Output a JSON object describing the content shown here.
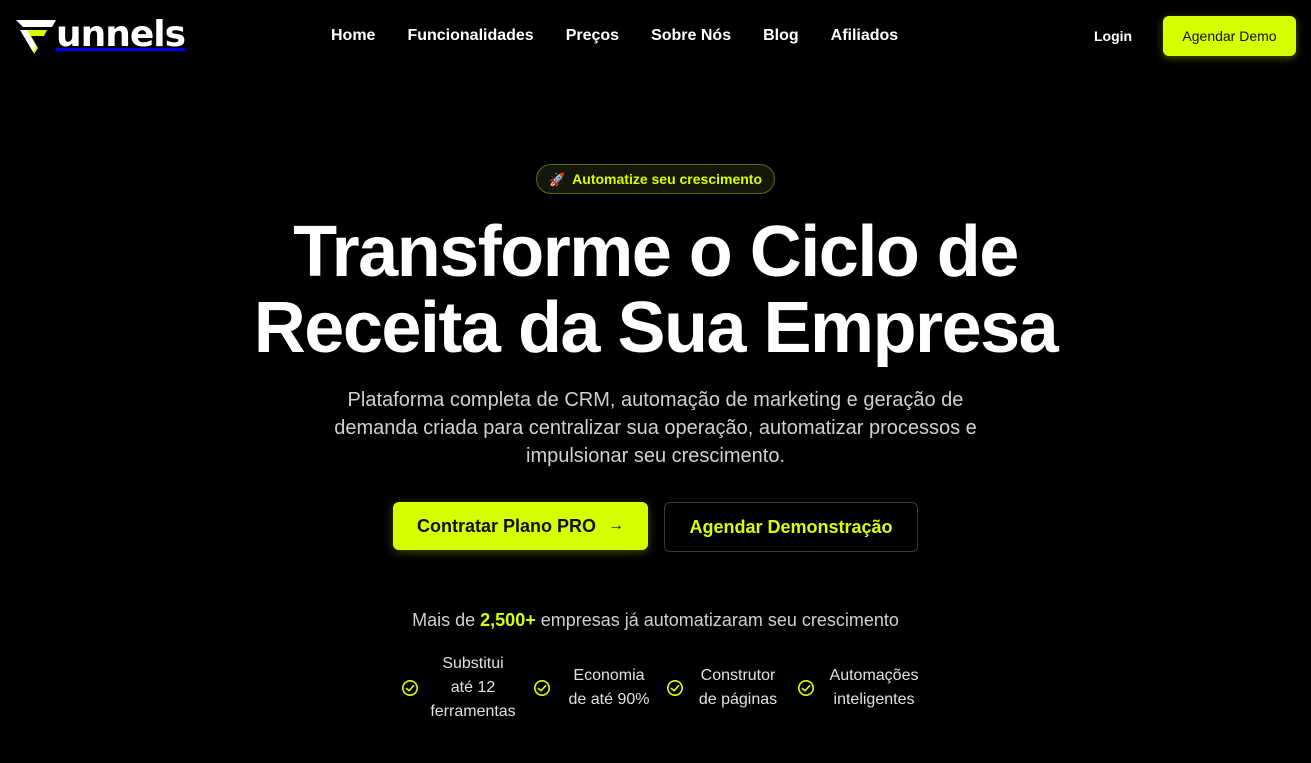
{
  "brand": {
    "name": "unnels",
    "accent": "#d7ff00"
  },
  "nav": {
    "items": [
      "Home",
      "Funcionalidades",
      "Preços",
      "Sobre Nós",
      "Blog",
      "Afiliados"
    ],
    "login": "Login",
    "demo_button": "Agendar Demo"
  },
  "hero": {
    "badge": "Automatize seu crescimento",
    "badge_icon": "rocket-icon",
    "title_line1": "Transforme o Ciclo de",
    "title_line2": "Receita da Sua Empresa",
    "subtitle": "Plataforma completa de CRM, automação de marketing e geração de demanda criada para centralizar sua operação, automatizar processos e impulsionar seu crescimento.",
    "cta_primary": "Contratar Plano PRO",
    "cta_secondary": "Agendar Demonstração"
  },
  "social_proof": {
    "prefix": "Mais de",
    "highlight": "2,500+",
    "suffix": "empresas já automatizaram seu crescimento"
  },
  "features": [
    {
      "lines": [
        "Substitui",
        "até 12",
        "ferramentas"
      ],
      "icon": "check-circle-icon"
    },
    {
      "lines": [
        "Economia",
        "de até 90%"
      ],
      "icon": "check-circle-icon"
    },
    {
      "lines": [
        "Construtor",
        "de páginas"
      ],
      "icon": "check-circle-icon"
    },
    {
      "lines": [
        "Automações",
        "inteligentes"
      ],
      "icon": "check-circle-icon"
    }
  ]
}
